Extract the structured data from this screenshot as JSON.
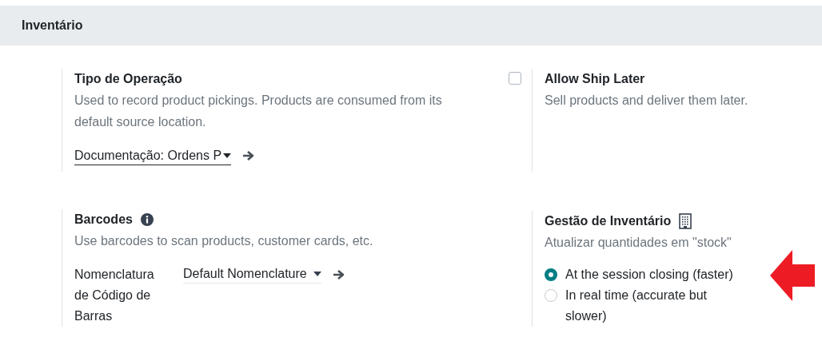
{
  "section": {
    "title": "Inventário"
  },
  "operation_type": {
    "title": "Tipo de Operação",
    "description": "Used to record product pickings. Products are consumed from its default source location.",
    "field": {
      "value": "Documentação: Ordens P"
    }
  },
  "ship_later": {
    "title": "Allow Ship Later",
    "description": "Sell products and deliver them later.",
    "checked": false
  },
  "barcodes": {
    "title": "Barcodes",
    "description": "Use barcodes to scan products, customer cards, etc.",
    "field_label": "Nomenclatura de Código de Barras",
    "field": {
      "value": "Default Nomenclature"
    }
  },
  "inventory_management": {
    "title": "Gestão de Inventário",
    "description": "Atualizar quantidades em \"stock\"",
    "options": [
      {
        "label": "At the session closing (faster)",
        "selected": true
      },
      {
        "label": "In real time (accurate but slower)",
        "selected": false
      }
    ]
  }
}
